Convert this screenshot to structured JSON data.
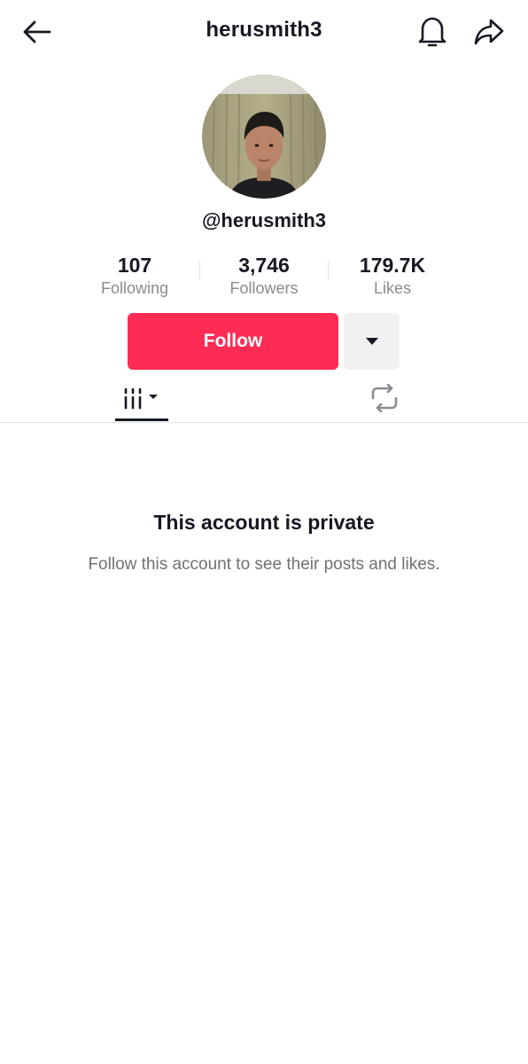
{
  "header": {
    "title": "herusmith3",
    "back_icon": "arrow-left-icon",
    "bell_icon": "bell-icon",
    "share_icon": "share-icon"
  },
  "profile": {
    "handle": "@herusmith3",
    "avatar_icon": "profile-photo"
  },
  "stats": [
    {
      "value": "107",
      "label": "Following"
    },
    {
      "value": "3,746",
      "label": "Followers"
    },
    {
      "value": "179.7K",
      "label": "Likes"
    }
  ],
  "actions": {
    "follow_label": "Follow",
    "more_icon": "caret-down-icon"
  },
  "tabs": {
    "videos_icon": "grid-lines-icon",
    "reposts_icon": "repost-icon"
  },
  "private_notice": {
    "title": "This account is private",
    "subtitle": "Follow this account to see their posts and likes."
  },
  "colors": {
    "accent": "#fe2c55",
    "text": "#161823",
    "muted": "#8a8b91",
    "secondary_button": "#f1f1f2"
  }
}
